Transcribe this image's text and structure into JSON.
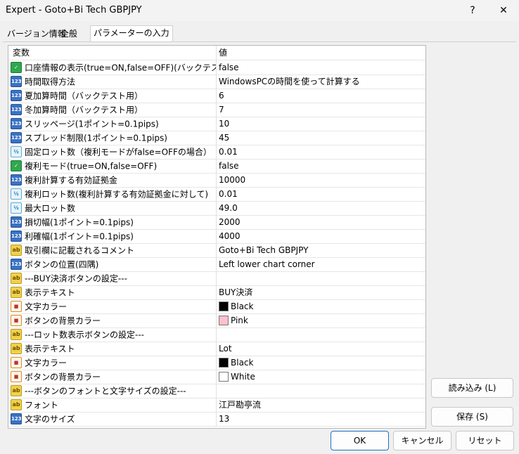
{
  "window": {
    "title": "Expert - Goto+Bi Tech GBPJPY",
    "help_label": "?",
    "close_label": "✕"
  },
  "tabs": [
    {
      "label": "バージョン情報"
    },
    {
      "label": "全般"
    },
    {
      "label": "パラメーターの入力"
    }
  ],
  "grid": {
    "header": {
      "name": "変数",
      "value": "値"
    },
    "rows": [
      {
        "icon": "bool",
        "name": "口座情報の表示(true=ON,false=OFF)(バックテスト時...",
        "value": "false"
      },
      {
        "icon": "int",
        "name": "時間取得方法",
        "value": "WindowsPCの時間を使って計算する"
      },
      {
        "icon": "int",
        "name": "夏加算時間（バックテスト用）",
        "value": "6"
      },
      {
        "icon": "int",
        "name": "冬加算時間（バックテスト用）",
        "value": "7"
      },
      {
        "icon": "int",
        "name": "スリッページ(1ポイント=0.1pips)",
        "value": "10"
      },
      {
        "icon": "int",
        "name": "スプレッド制限(1ポイント=0.1pips)",
        "value": "45"
      },
      {
        "icon": "dbl",
        "name": "固定ロット数（複利モードがfalse=OFFの場合）",
        "value": "0.01"
      },
      {
        "icon": "bool",
        "name": "複利モード(true=ON,false=OFF)",
        "value": "false"
      },
      {
        "icon": "int",
        "name": "複利計算する有効証拠金",
        "value": "10000"
      },
      {
        "icon": "dbl",
        "name": "複利ロット数(複利計算する有効証拠金に対して)",
        "value": "0.01"
      },
      {
        "icon": "dbl",
        "name": "最大ロット数",
        "value": "49.0"
      },
      {
        "icon": "int",
        "name": "損切幅(1ポイント=0.1pips)",
        "value": "2000"
      },
      {
        "icon": "int",
        "name": "利確幅(1ポイント=0.1pips)",
        "value": "4000"
      },
      {
        "icon": "str",
        "name": "取引欄に記載されるコメント",
        "value": "Goto+Bi Tech GBPJPY"
      },
      {
        "icon": "int",
        "name": "ボタンの位置(四隅)",
        "value": "Left lower chart corner"
      },
      {
        "icon": "str",
        "name": "---BUY決済ボタンの設定---",
        "value": ""
      },
      {
        "icon": "str",
        "name": "表示テキスト",
        "value": "BUY決済"
      },
      {
        "icon": "clr",
        "name": "文字カラー",
        "value": "Black",
        "swatch": "#000000"
      },
      {
        "icon": "clr",
        "name": "ボタンの背景カラー",
        "value": "Pink",
        "swatch": "#ffc0cb"
      },
      {
        "icon": "str",
        "name": "---ロット数表示ボタンの設定---",
        "value": ""
      },
      {
        "icon": "str",
        "name": "表示テキスト",
        "value": "Lot"
      },
      {
        "icon": "clr",
        "name": "文字カラー",
        "value": "Black",
        "swatch": "#000000"
      },
      {
        "icon": "clr",
        "name": "ボタンの背景カラー",
        "value": "White",
        "swatch": "#ffffff"
      },
      {
        "icon": "str",
        "name": "---ボタンのフォントと文字サイズの設定---",
        "value": ""
      },
      {
        "icon": "str",
        "name": "フォント",
        "value": "江戸勘亭流"
      },
      {
        "icon": "int",
        "name": "文字のサイズ",
        "value": "13"
      }
    ]
  },
  "icons": {
    "bool": {
      "name": "boolean-icon",
      "glyph": "✓"
    },
    "int": {
      "name": "integer-icon",
      "glyph": "123"
    },
    "dbl": {
      "name": "double-icon",
      "glyph": "½"
    },
    "str": {
      "name": "string-icon",
      "glyph": "ab"
    },
    "clr": {
      "name": "color-icon",
      "glyph": "■"
    }
  },
  "buttons": {
    "load": "読み込み (L)",
    "save": "保存 (S)",
    "ok": "OK",
    "cancel": "キャンセル",
    "reset": "リセット"
  }
}
